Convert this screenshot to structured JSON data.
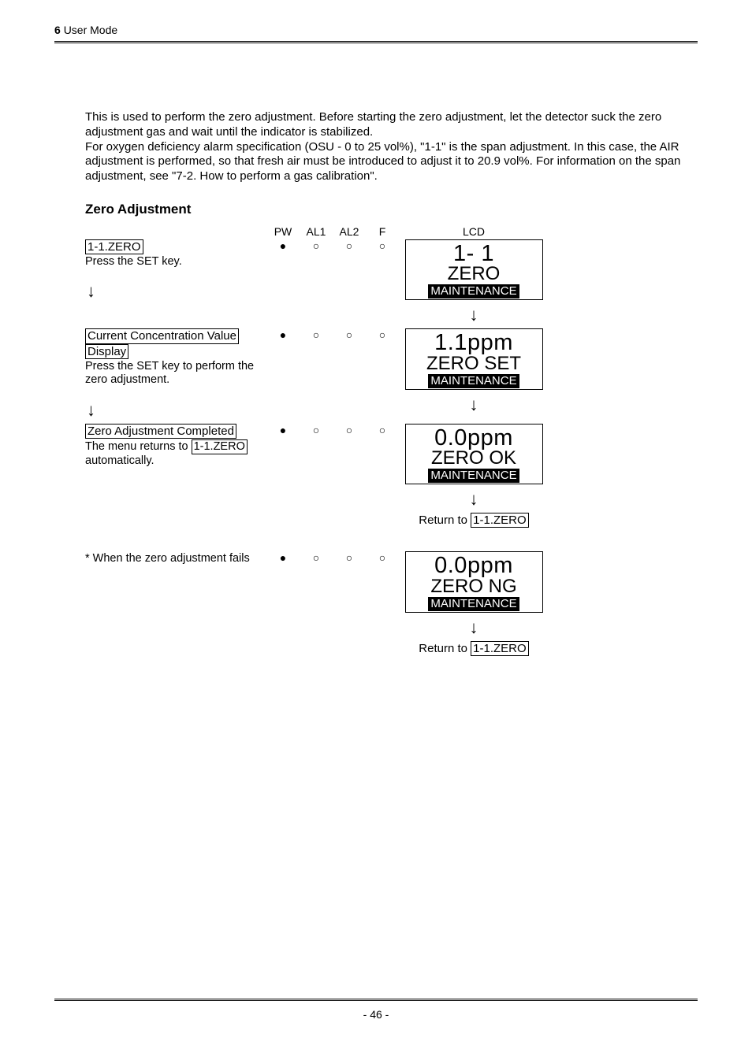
{
  "header": {
    "chapter_num": "6",
    "chapter_title": "User Mode"
  },
  "footer": {
    "page": "- 46 -"
  },
  "intro": {
    "p1": "This is used to perform the zero adjustment. Before starting the zero adjustment, let the detector suck the zero adjustment gas and wait until the indicator is stabilized.",
    "p2": "For oxygen deficiency alarm specification (OSU - 0 to 25 vol%), \"1-1\" is the span adjustment. In this case, the AIR adjustment is performed, so that fresh air must be introduced to adjust it to 20.9 vol%. For information on the span adjustment, see \"7-2. How to perform a gas calibration\"."
  },
  "section_title": "Zero Adjustment",
  "cols": {
    "pw": "PW",
    "al1": "AL1",
    "al2": "AL2",
    "f": "F",
    "lcd": "LCD"
  },
  "steps": {
    "s1": {
      "title": "1-1.ZERO",
      "desc": "Press the SET key.",
      "lcd": {
        "line1": "1- 1",
        "line2": "ZERO",
        "tag": "MAINTENANCE"
      }
    },
    "s2": {
      "title": "Current Concentration Value Display",
      "title_l1": "Current Concentration Value",
      "title_l2": "Display",
      "desc": "Press the SET key to perform the zero adjustment.",
      "lcd": {
        "line1": "1.1ppm",
        "line2": "ZERO SET",
        "tag": "MAINTENANCE"
      }
    },
    "s3": {
      "title": "Zero Adjustment Completed",
      "desc_prefix": "The menu returns to ",
      "desc_box": "1-1.ZERO",
      "desc_suffix": " automatically.",
      "lcd": {
        "line1": "0.0ppm",
        "line2": "ZERO OK",
        "tag": "MAINTENANCE"
      },
      "return_prefix": "Return to ",
      "return_box": "1-1.ZERO"
    },
    "s4": {
      "note": "* When the zero adjustment fails",
      "lcd": {
        "line1": "0.0ppm",
        "line2": "ZERO NG",
        "tag": "MAINTENANCE"
      },
      "return_prefix": "Return to ",
      "return_box": "1-1.ZERO"
    }
  }
}
